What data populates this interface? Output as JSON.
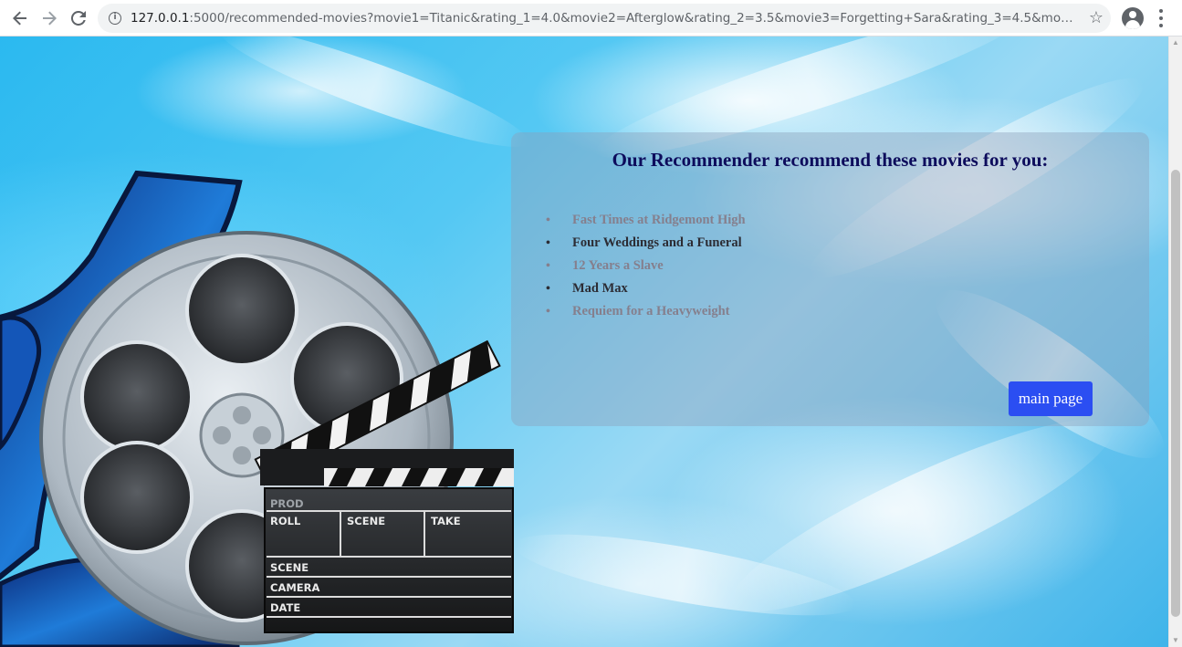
{
  "browser": {
    "url_host": "127.0.0.1",
    "url_rest": ":5000/recommended-movies?movie1=Titanic&rating_1=4.0&movie2=Afterglow&rating_2=3.5&movie3=Forgetting+Sara&rating_3=4.5&movie4=Bella&ra...",
    "back_icon": "arrow-left-icon",
    "forward_icon": "arrow-right-icon",
    "reload_icon": "reload-icon"
  },
  "page": {
    "title": "Our Recommender recommend these movies for you:",
    "movies": [
      {
        "name": "Fast Times at Ridgemont High",
        "color": "#857f8d"
      },
      {
        "name": "Four Weddings and a Funeral",
        "color": "#2c2c34"
      },
      {
        "name": "12 Years a Slave",
        "color": "#857f8d"
      },
      {
        "name": "Mad Max",
        "color": "#2c2c34"
      },
      {
        "name": "Requiem for a Heavyweight",
        "color": "#857f8d"
      }
    ],
    "main_page_label": "main page",
    "clapper": {
      "prod": "PROD",
      "roll": "ROLL",
      "scene": "SCENE",
      "take": "TAKE",
      "scene2": "SCENE",
      "camera": "CAMERA",
      "date": "DATE"
    }
  },
  "colors": {
    "title": "#0d0c5c",
    "button": "#2b4ef2"
  }
}
